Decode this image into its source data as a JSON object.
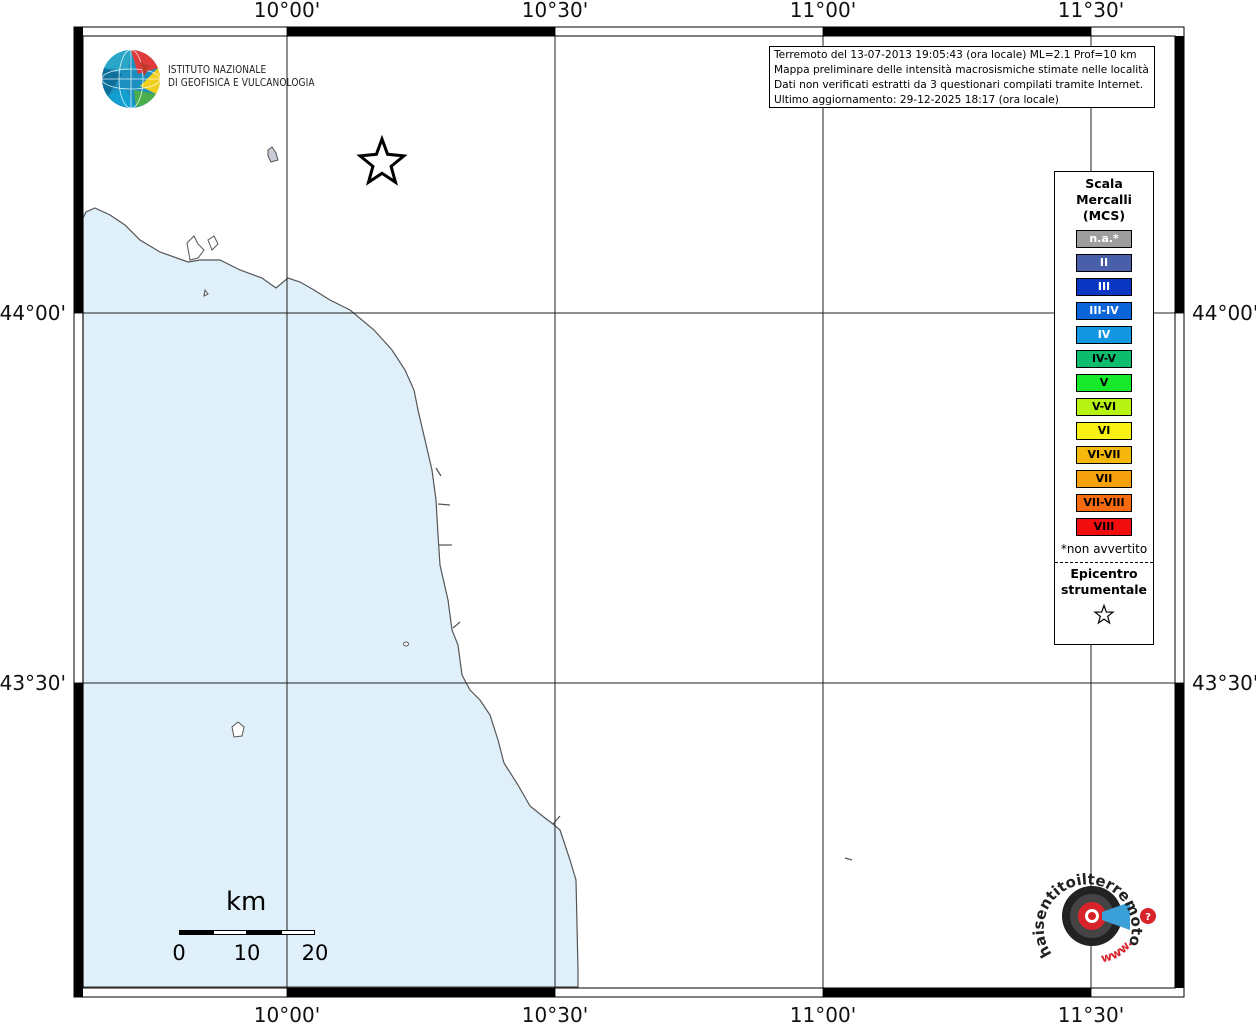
{
  "map": {
    "lon_range": [
      "9°36'",
      "11°41'"
    ],
    "lat_range": [
      "43°07'",
      "44°22'"
    ],
    "top_lon_labels": [
      "10°00'",
      "10°30'",
      "11°00'",
      "11°30'"
    ],
    "bottom_lon_labels": [
      "10°00'",
      "10°30'",
      "11°00'",
      "11°30'"
    ],
    "left_lat_labels": [
      "44°00'",
      "43°30'"
    ],
    "right_lat_labels": [
      "44°00'",
      "43°30'"
    ],
    "sea_color": "#dff0fb",
    "land_color": "#ffffff",
    "coastline_color": "#555555",
    "grid_color": "#222222",
    "epicenter": {
      "lon": "10°10'",
      "lat": "44°12'",
      "symbol": "star-icon"
    }
  },
  "info_box": {
    "line1": "Terremoto del 13-07-2013 19:05:43 (ora locale) ML=2.1 Prof=10 km",
    "line2": "Mappa preliminare delle intensità macrosismiche stimate nelle località",
    "line3": "Dati non verificati estratti da 3 questionari compilati tramite Internet.",
    "line4": "Ultimo aggiornamento: 29-12-2025 18:17 (ora locale)"
  },
  "logo": {
    "line1": "ISTITUTO NAZIONALE",
    "line2": "DI GEOFISICA E VULCANOLOGIA"
  },
  "legend": {
    "title_line1": "Scala",
    "title_line2": "Mercalli",
    "title_line3": "(MCS)",
    "items": [
      {
        "label": "n.a.*",
        "color": "#9e9e9e",
        "text_color": "#ffffff"
      },
      {
        "label": "II",
        "color": "#4a5faa",
        "text_color": "#ffffff"
      },
      {
        "label": "III",
        "color": "#0a36c2",
        "text_color": "#ffffff"
      },
      {
        "label": "III-IV",
        "color": "#0a66d8",
        "text_color": "#ffffff"
      },
      {
        "label": "IV",
        "color": "#1296e2",
        "text_color": "#ffffff"
      },
      {
        "label": "IV-V",
        "color": "#0ebc6e",
        "text_color": "#000000"
      },
      {
        "label": "V",
        "color": "#18e82a",
        "text_color": "#000000"
      },
      {
        "label": "V-VI",
        "color": "#b6f212",
        "text_color": "#000000"
      },
      {
        "label": "VI",
        "color": "#f7f214",
        "text_color": "#000000"
      },
      {
        "label": "VI-VII",
        "color": "#f7b80e",
        "text_color": "#000000"
      },
      {
        "label": "VII",
        "color": "#f7a00e",
        "text_color": "#000000"
      },
      {
        "label": "VII-VIII",
        "color": "#f76a0e",
        "text_color": "#000000"
      },
      {
        "label": "VIII",
        "color": "#f20e0e",
        "text_color": "#000000"
      }
    ],
    "note": "*non avvertito",
    "epicenter_line1": "Epicentro",
    "epicenter_line2": "strumentale"
  },
  "scale_bar": {
    "unit": "km",
    "ticks": [
      "0",
      "10",
      "20"
    ]
  },
  "badge": {
    "text": "haisentitoilterremoto.it",
    "url_text": "www."
  }
}
